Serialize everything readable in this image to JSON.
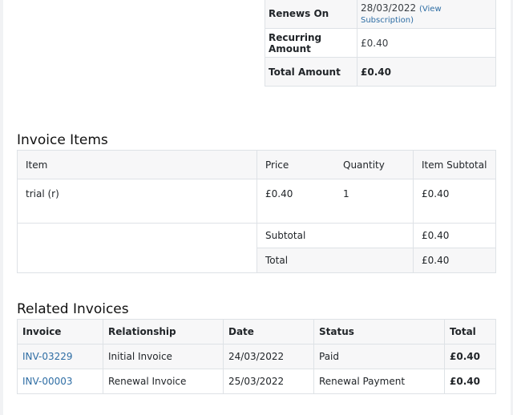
{
  "summary": {
    "rows": [
      {
        "label": "Renews On",
        "value": "28/03/2022",
        "link": "(View Subscription)"
      },
      {
        "label": "Recurring Amount",
        "value": "£0.40"
      },
      {
        "label": "Total Amount",
        "value": "£0.40"
      }
    ]
  },
  "invoice_items": {
    "heading": "Invoice Items",
    "columns": [
      "Item",
      "Price",
      "Quantity",
      "Item Subtotal"
    ],
    "rows": [
      {
        "item": "trial (r)",
        "price": "£0.40",
        "quantity": "1",
        "subtotal": "£0.40"
      }
    ],
    "subtotal_label": "Subtotal",
    "subtotal_value": "£0.40",
    "total_label": "Total",
    "total_value": "£0.40"
  },
  "related_invoices": {
    "heading": "Related Invoices",
    "columns": [
      "Invoice",
      "Relationship",
      "Date",
      "Status",
      "Total"
    ],
    "rows": [
      {
        "invoice": "INV-03229",
        "relationship": "Initial Invoice",
        "date": "24/03/2022",
        "status": "Paid",
        "total": "£0.40"
      },
      {
        "invoice": "INV-00003",
        "relationship": "Renewal Invoice",
        "date": "25/03/2022",
        "status": "Renewal Payment",
        "total": "£0.40"
      }
    ]
  }
}
